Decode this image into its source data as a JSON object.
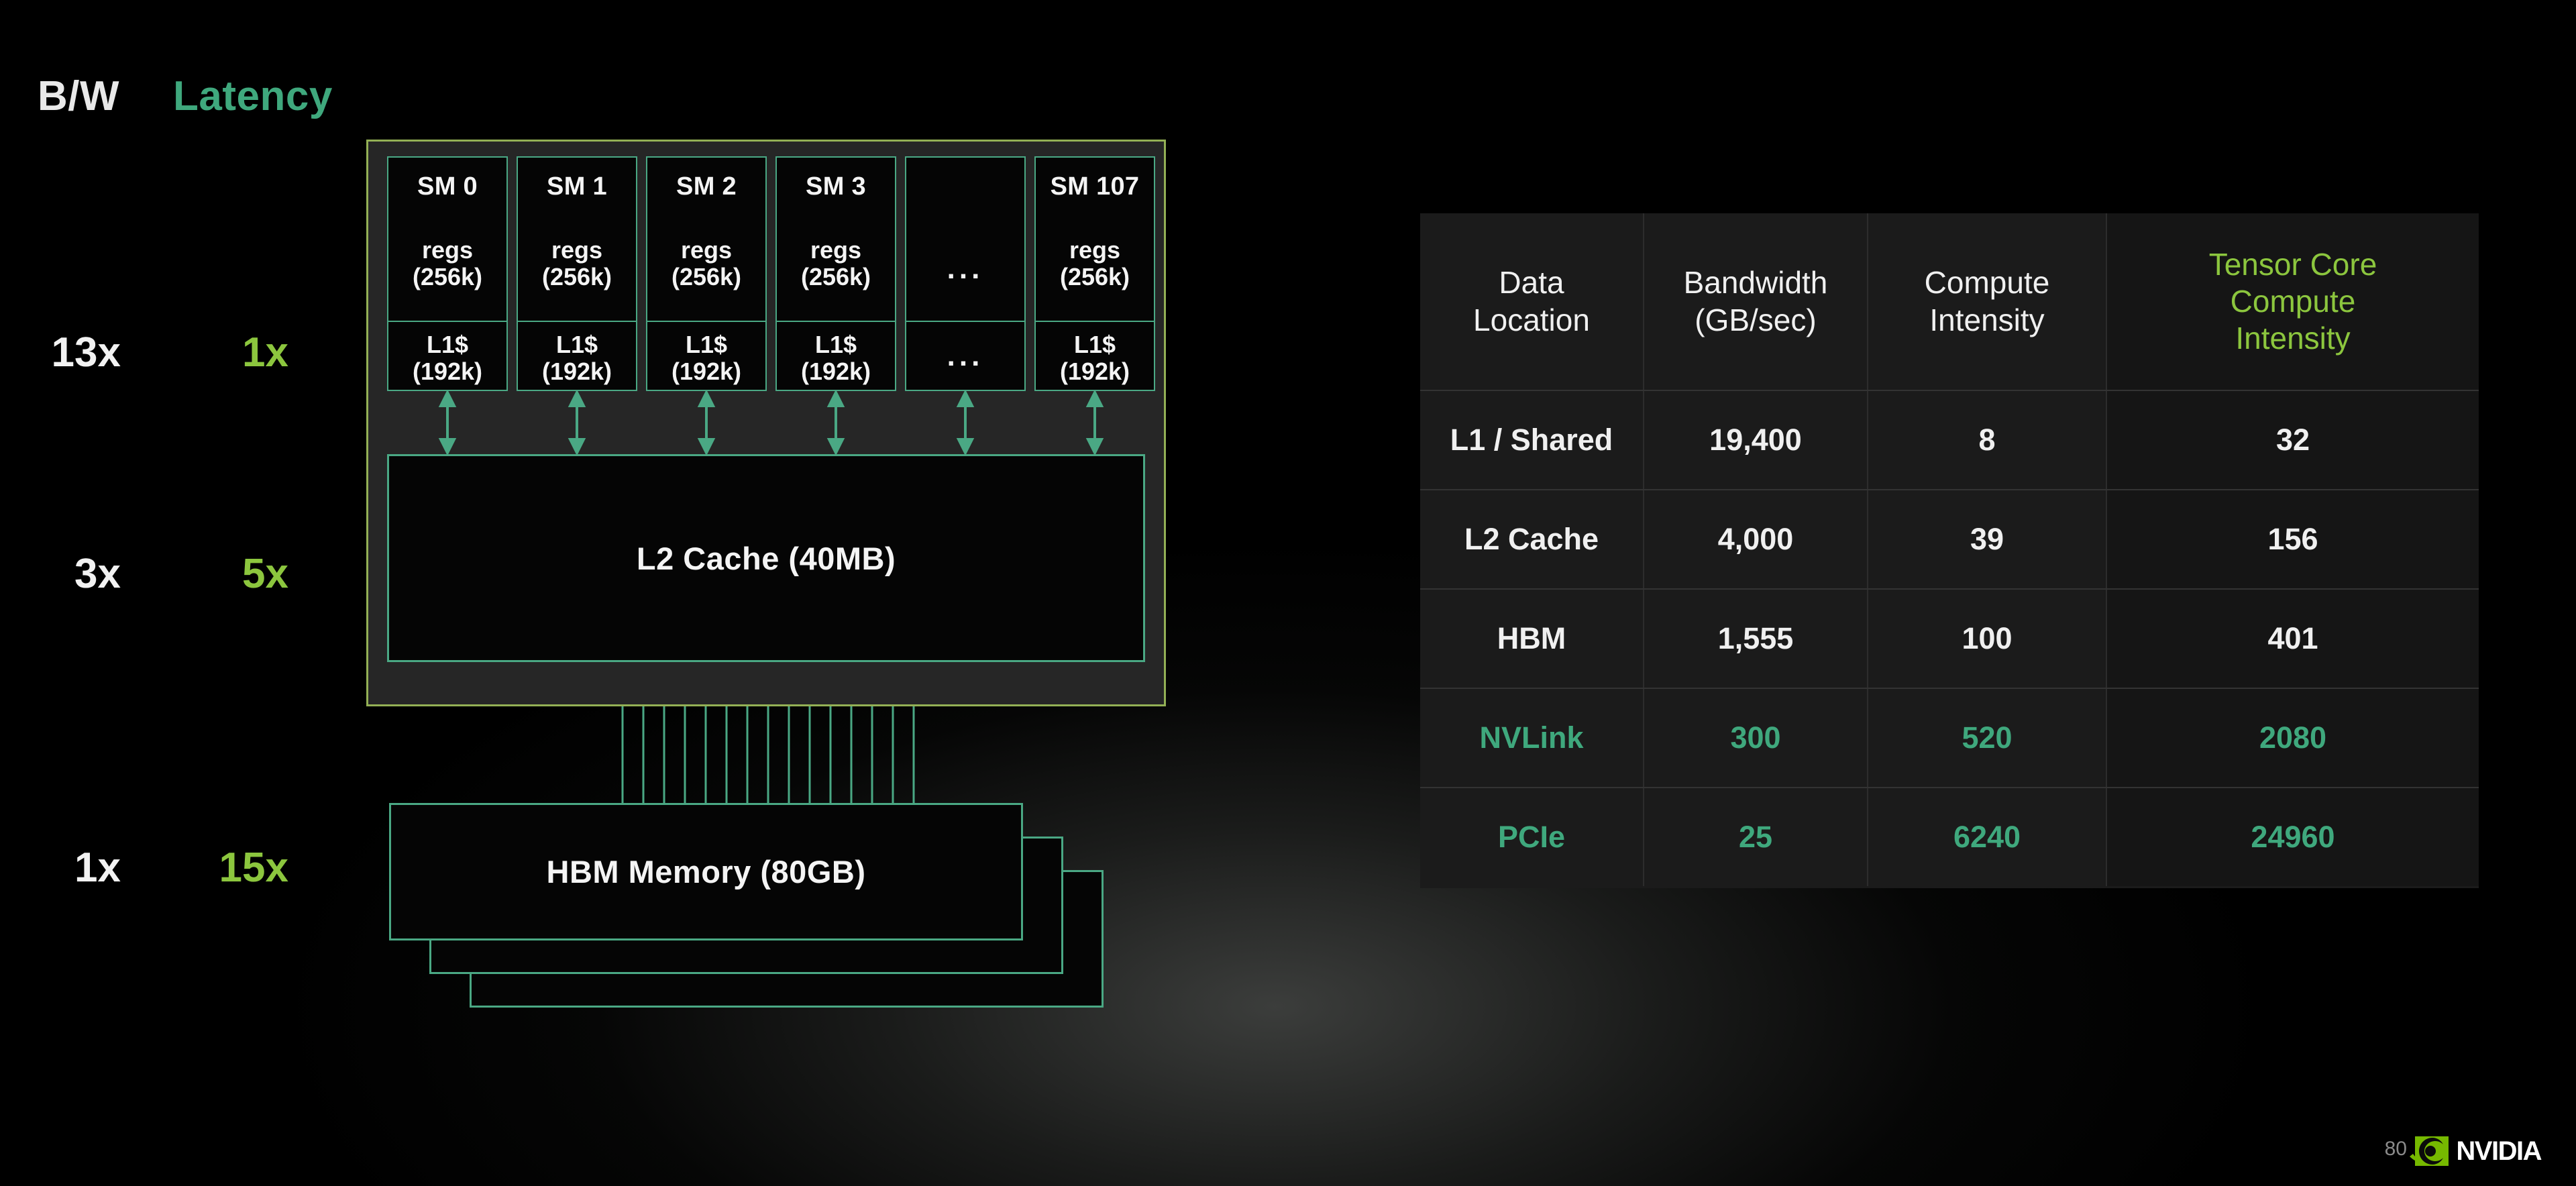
{
  "legend": {
    "bandwidth_header": "B/W",
    "latency_header": "Latency",
    "rows": [
      {
        "bandwidth": "13x",
        "latency": "1x"
      },
      {
        "bandwidth": "3x",
        "latency": "5x"
      },
      {
        "bandwidth": "1x",
        "latency": "15x"
      }
    ]
  },
  "diagram": {
    "sms": [
      {
        "title": "SM 0",
        "regs": "regs\n(256k)",
        "l1": "L1$\n(192k)"
      },
      {
        "title": "SM 1",
        "regs": "regs\n(256k)",
        "l1": "L1$\n(192k)"
      },
      {
        "title": "SM 2",
        "regs": "regs\n(256k)",
        "l1": "L1$\n(192k)"
      },
      {
        "title": "SM 3",
        "regs": "regs\n(256k)",
        "l1": "L1$\n(192k)"
      },
      {
        "title": "",
        "regs": "...",
        "l1": "..."
      },
      {
        "title": "SM 107",
        "regs": "regs\n(256k)",
        "l1": "L1$\n(192k)"
      }
    ],
    "l2_label": "L2 Cache (40MB)",
    "hbm_label": "HBM Memory (80GB)"
  },
  "table": {
    "headers": [
      "Data\nLocation",
      "Bandwidth\n(GB/sec)",
      "Compute\nIntensity",
      "Tensor Core\nCompute\nIntensity"
    ],
    "rows": [
      {
        "location": "L1 / Shared",
        "bandwidth": "19,400",
        "compute_intensity": "8",
        "tensor_core_compute_intensity": "32",
        "muted": false
      },
      {
        "location": "L2 Cache",
        "bandwidth": "4,000",
        "compute_intensity": "39",
        "tensor_core_compute_intensity": "156",
        "muted": false
      },
      {
        "location": "HBM",
        "bandwidth": "1,555",
        "compute_intensity": "100",
        "tensor_core_compute_intensity": "401",
        "muted": false
      },
      {
        "location": "NVLink",
        "bandwidth": "300",
        "compute_intensity": "520",
        "tensor_core_compute_intensity": "2080",
        "muted": true
      },
      {
        "location": "PCIe",
        "bandwidth": "25",
        "compute_intensity": "6240",
        "tensor_core_compute_intensity": "24960",
        "muted": true
      }
    ]
  },
  "footer": {
    "slide_number": "80",
    "brand": "NVIDIA"
  },
  "colors": {
    "accent_green": "#8cc63e",
    "muted_green": "#3fa87d",
    "gpu_border": "#93b055",
    "block_border": "#4aa884",
    "text_white": "#f4f4f4"
  }
}
